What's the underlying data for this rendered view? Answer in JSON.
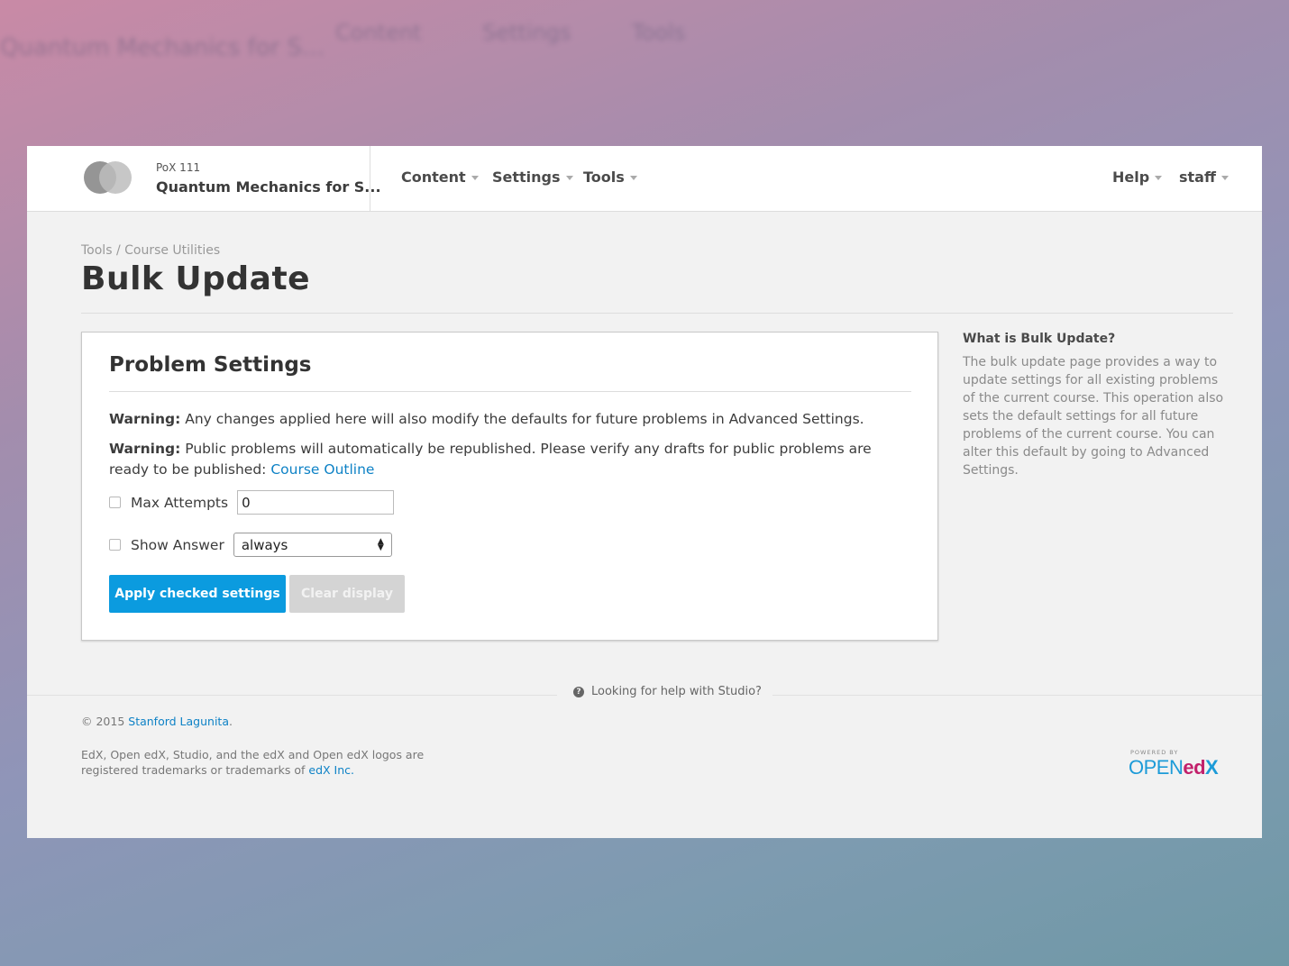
{
  "background": {
    "ghost_title": "Quantum Mechanics for S...",
    "ghost_nav": [
      "Content",
      "Settings",
      "Tools"
    ]
  },
  "header": {
    "course_id": "PoX 111",
    "course_name": "Quantum Mechanics for S...",
    "nav": {
      "content": "Content",
      "settings": "Settings",
      "tools": "Tools",
      "help": "Help",
      "user": "staff"
    }
  },
  "page": {
    "breadcrumb": "Tools / Course Utilities",
    "title": "Bulk Update"
  },
  "card": {
    "title": "Problem Settings",
    "warning1_label": "Warning:",
    "warning1_text": " Any changes applied here will also modify the defaults for future problems in Advanced Settings.",
    "warning2_label": "Warning:",
    "warning2_text": " Public problems will automatically be republished. Please verify any drafts for public problems are ready to be published: ",
    "warning2_link": "Course Outline",
    "max_attempts": {
      "label": "Max Attempts",
      "value": "0",
      "checked": false
    },
    "show_answer": {
      "label": "Show Answer",
      "selected": "always",
      "checked": false
    },
    "apply_button": "Apply checked settings",
    "clear_button": "Clear display"
  },
  "sidebar": {
    "heading": "What is Bulk Update?",
    "text": "The bulk update page provides a way to update settings for all existing problems of the current course. This operation also sets the default settings for all future problems of the current course. You can alter this default by going to Advanced Settings."
  },
  "footer": {
    "help_link": "Looking for help with Studio?",
    "copyright_prefix": "© 2015 ",
    "copyright_link": "Stanford Lagunita",
    "copyright_suffix": ".",
    "legal_text": "EdX, Open edX, Studio, and the edX and Open edX logos are registered trademarks or trademarks of ",
    "legal_link": "edX Inc.",
    "powered_by": "POWERED BY",
    "logo_open": "OPEN",
    "logo_ed": "ed",
    "logo_x": "X"
  },
  "colors": {
    "primary_button": "#0b9bdf",
    "link": "#0e82c6",
    "disabled_button": "#d4d4d4"
  }
}
